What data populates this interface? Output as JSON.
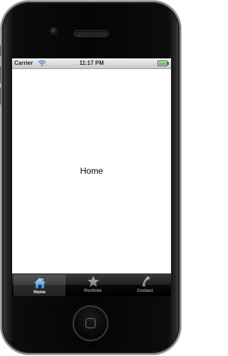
{
  "status_bar": {
    "carrier": "Carrier",
    "time": "11:17 PM",
    "wifi_icon": "wifi-icon",
    "battery_icon": "battery-icon",
    "battery_level": 1.0
  },
  "content": {
    "label": "Home"
  },
  "tab_bar": {
    "selected": "Home",
    "tabs": [
      {
        "label": "Home",
        "icon": "house-icon",
        "active": true
      },
      {
        "label": "Portfolio",
        "icon": "star-icon",
        "active": false
      },
      {
        "label": "Contact",
        "icon": "phone-handset-icon",
        "active": false
      }
    ]
  },
  "colors": {
    "active_tab_icon": "#5fa8ef",
    "inactive_tab_icon": "#9b9b9b",
    "battery_fill": "#2bb51b"
  }
}
